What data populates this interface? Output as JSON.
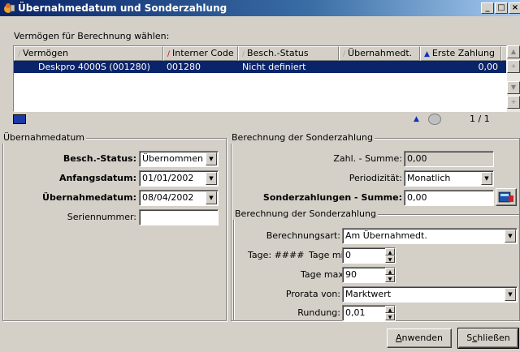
{
  "window": {
    "title": "Übernahmedatum und Sonderzahlung",
    "controls": [
      "_",
      "□",
      "×"
    ]
  },
  "list": {
    "caption": "Vermögen für Berechnung wählen:",
    "columns": [
      {
        "label": "Vermögen",
        "sort": "none"
      },
      {
        "label": "Interner Code",
        "sort": "red"
      },
      {
        "label": "Besch.-Status",
        "sort": "none"
      },
      {
        "label": "Übernahmedt.",
        "sort": "none"
      },
      {
        "label": "Erste Zahlung",
        "sort": "blue"
      }
    ],
    "rows": [
      {
        "vermoegen": "Deskpro 4000S (001280)",
        "code": "001280",
        "status": "Nicht definiert",
        "uebernahme": "",
        "zahlung": "0,00"
      }
    ],
    "page_counter": "1 / 1"
  },
  "left_group": {
    "title": "Übernahmedatum",
    "besch_status": {
      "label": "Besch.-Status:",
      "value": "Übernommen"
    },
    "anfangsdatum": {
      "label": "Anfangsdatum:",
      "value": "01/01/2002"
    },
    "uebernahmedatum": {
      "label": "Übernahmedatum:",
      "value": "08/04/2002"
    },
    "seriennummer": {
      "label": "Seriennummer:",
      "value": ""
    }
  },
  "right_group": {
    "title": "Berechnung der Sonderzahlung",
    "zahl_summe": {
      "label": "Zahl. - Summe:",
      "value": "0,00"
    },
    "periodizitaet": {
      "label": "Periodizität:",
      "value": "Monatlich"
    },
    "sonderzahlungen": {
      "label": "Sonderzahlungen - Summe:",
      "value": "0,00"
    },
    "inner": {
      "title": "Berechnung der Sonderzahlung",
      "berechnungsart": {
        "label": "Berechnungsart:",
        "value": "Am Übernahmedt."
      },
      "tage": "Tage: ####",
      "tage_min": {
        "label": "Tage min.:",
        "value": "0"
      },
      "tage_max": {
        "label": "Tage max.:",
        "value": "90"
      },
      "prorata": {
        "label": "Prorata von:",
        "value": "Marktwert"
      },
      "rundung": {
        "label": "Rundung:",
        "value": "0,01"
      }
    }
  },
  "buttons": {
    "anwenden": {
      "pre": "",
      "accel": "A",
      "post": "nwenden"
    },
    "schliessen": {
      "pre": "S",
      "accel": "c",
      "post": "hließen"
    }
  },
  "colors": {
    "title_start": "#0a246a",
    "selection": "#0a246a",
    "face": "#d4d0c8"
  }
}
